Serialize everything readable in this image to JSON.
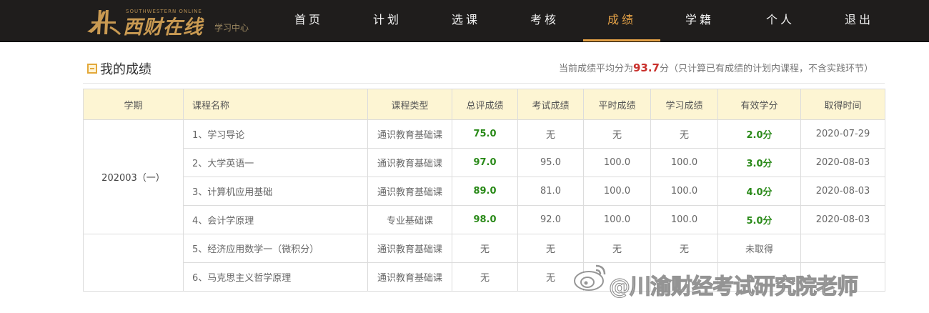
{
  "header": {
    "logo_title": "西财在线",
    "logo_en": "SOUTHWESTERN ONLINE",
    "logo_sub": "学习中心",
    "nav": [
      {
        "label": "首页",
        "active": false
      },
      {
        "label": "计划",
        "active": false
      },
      {
        "label": "选课",
        "active": false
      },
      {
        "label": "考核",
        "active": false
      },
      {
        "label": "成绩",
        "active": true
      },
      {
        "label": "学籍",
        "active": false
      },
      {
        "label": "个人",
        "active": false
      },
      {
        "label": "退出",
        "active": false
      }
    ]
  },
  "section": {
    "title": "我的成绩",
    "avg_prefix": "当前成绩平均分为",
    "avg_value": "93.7",
    "avg_suffix": "分（只计算已有成绩的计划内课程，不含实践环节）"
  },
  "table": {
    "columns": [
      "学期",
      "课程名称",
      "课程类型",
      "总评成绩",
      "考试成绩",
      "平时成绩",
      "学习成绩",
      "有效学分",
      "取得时间"
    ],
    "groups": [
      {
        "term": "202003（一）",
        "rows": [
          {
            "name": "1、学习导论",
            "type": "通识教育基础课",
            "total": "75.0",
            "exam": "无",
            "usual": "无",
            "study": "无",
            "credit": "2.0分",
            "date": "2020-07-29"
          },
          {
            "name": "2、大学英语一",
            "type": "通识教育基础课",
            "total": "97.0",
            "exam": "95.0",
            "usual": "100.0",
            "study": "100.0",
            "credit": "3.0分",
            "date": "2020-08-03"
          },
          {
            "name": "3、计算机应用基础",
            "type": "通识教育基础课",
            "total": "89.0",
            "exam": "81.0",
            "usual": "100.0",
            "study": "100.0",
            "credit": "4.0分",
            "date": "2020-08-03"
          },
          {
            "name": "4、会计学原理",
            "type": "专业基础课",
            "total": "98.0",
            "exam": "92.0",
            "usual": "100.0",
            "study": "100.0",
            "credit": "5.0分",
            "date": "2020-08-03"
          }
        ]
      },
      {
        "term": "",
        "rows": [
          {
            "name": "5、经济应用数学一（微积分）",
            "type": "通识教育基础课",
            "total": "无",
            "exam": "无",
            "usual": "无",
            "study": "无",
            "credit": "未取得",
            "date": ""
          },
          {
            "name": "6、马克思主义哲学原理",
            "type": "通识教育基础课",
            "total": "无",
            "exam": "无",
            "usual": "",
            "study": "",
            "credit": "",
            "date": ""
          }
        ]
      }
    ]
  },
  "watermark": {
    "text": "@川渝财经考试研究院老师",
    "icon": "weibo-icon"
  },
  "colors": {
    "nav_bg": "#1f1d1c",
    "nav_active": "#e6a347",
    "header_row_bg": "#fdf5d3",
    "score_green": "#2a8a19",
    "avg_red": "#c9302c"
  }
}
